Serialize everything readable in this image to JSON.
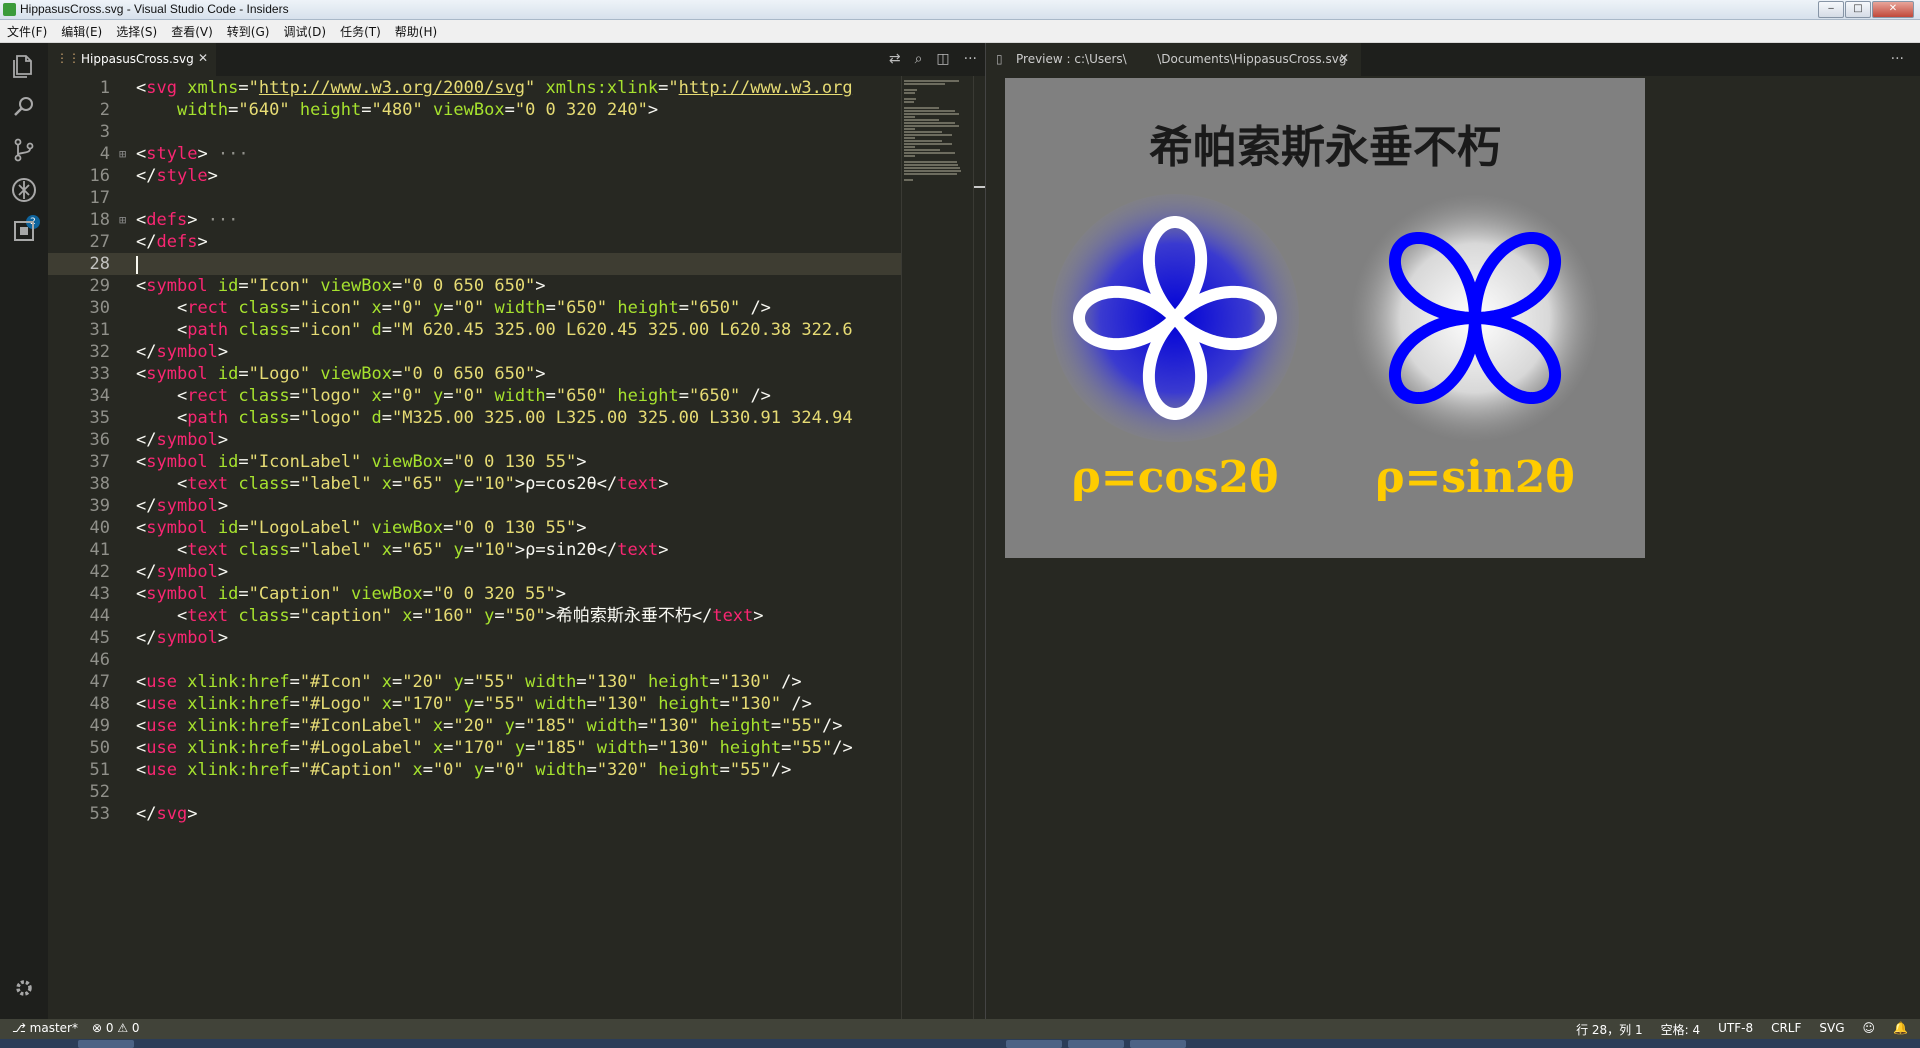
{
  "window": {
    "title": "HippasusCross.svg - Visual Studio Code - Insiders",
    "minimize": "‒",
    "maximize": "□",
    "close": "✕"
  },
  "menu": [
    "文件(F)",
    "编辑(E)",
    "选择(S)",
    "查看(V)",
    "转到(G)",
    "调试(D)",
    "任务(T)",
    "帮助(H)"
  ],
  "activity": {
    "explorer": "explorer-icon",
    "search": "search-icon",
    "scm": "source-control-icon",
    "scm_badge": "2",
    "debug": "debug-icon",
    "extensions": "extensions-icon",
    "settings": "gear-icon"
  },
  "tabs": {
    "editor": {
      "label": "HippasusCross.svg",
      "close": "✕"
    },
    "preview": {
      "label": "Preview : c:\\Users\\        \\Documents\\HippasusCross.svg",
      "close": "✕"
    },
    "more": "···"
  },
  "code_lines": [
    {
      "n": "1",
      "fold": false,
      "html": "<span class=\"p\">&lt;</span><span class=\"t\">svg</span> <span class=\"a\">xmlns</span><span class=\"p\">=</span><span class=\"s\">\"</span><span class=\"u\">http://www.w3.org/2000/svg</span><span class=\"s\">\"</span> <span class=\"a\">xmlns:xlink</span><span class=\"p\">=</span><span class=\"s\">\"</span><span class=\"u\">http://www.w3.org</span>"
    },
    {
      "n": "2",
      "fold": false,
      "html": "    <span class=\"a\">width</span><span class=\"p\">=</span><span class=\"s\">\"640\"</span> <span class=\"a\">height</span><span class=\"p\">=</span><span class=\"s\">\"480\"</span> <span class=\"a\">viewBox</span><span class=\"p\">=</span><span class=\"s\">\"0 0 320 240\"</span><span class=\"p\">&gt;</span>"
    },
    {
      "n": "3",
      "fold": false,
      "html": ""
    },
    {
      "n": "4",
      "fold": true,
      "html": "<span class=\"p\">&lt;</span><span class=\"t\">style</span><span class=\"p\">&gt;</span><span class=\"g\"> ···</span>"
    },
    {
      "n": "16",
      "fold": false,
      "html": "<span class=\"p\">&lt;/</span><span class=\"t\">style</span><span class=\"p\">&gt;</span>"
    },
    {
      "n": "17",
      "fold": false,
      "html": ""
    },
    {
      "n": "18",
      "fold": true,
      "html": "<span class=\"p\">&lt;</span><span class=\"t\">defs</span><span class=\"p\">&gt;</span><span class=\"g\"> ···</span>"
    },
    {
      "n": "27",
      "fold": false,
      "html": "<span class=\"p\">&lt;/</span><span class=\"t\">defs</span><span class=\"p\">&gt;</span>"
    },
    {
      "n": "28",
      "fold": false,
      "current": true,
      "html": ""
    },
    {
      "n": "29",
      "fold": false,
      "html": "<span class=\"p\">&lt;</span><span class=\"t\">symbol</span> <span class=\"a\">id</span><span class=\"p\">=</span><span class=\"s\">\"Icon\"</span> <span class=\"a\">viewBox</span><span class=\"p\">=</span><span class=\"s\">\"0 0 650 650\"</span><span class=\"p\">&gt;</span>"
    },
    {
      "n": "30",
      "fold": false,
      "html": "    <span class=\"p\">&lt;</span><span class=\"t\">rect</span> <span class=\"a\">class</span><span class=\"p\">=</span><span class=\"s\">\"icon\"</span> <span class=\"a\">x</span><span class=\"p\">=</span><span class=\"s\">\"0\"</span> <span class=\"a\">y</span><span class=\"p\">=</span><span class=\"s\">\"0\"</span> <span class=\"a\">width</span><span class=\"p\">=</span><span class=\"s\">\"650\"</span> <span class=\"a\">height</span><span class=\"p\">=</span><span class=\"s\">\"650\"</span> <span class=\"p\">/&gt;</span>"
    },
    {
      "n": "31",
      "fold": false,
      "html": "    <span class=\"p\">&lt;</span><span class=\"t\">path</span> <span class=\"a\">class</span><span class=\"p\">=</span><span class=\"s\">\"icon\"</span> <span class=\"a\">d</span><span class=\"p\">=</span><span class=\"s\">\"M 620.45 325.00 L620.45 325.00 L620.38 322.6</span>"
    },
    {
      "n": "32",
      "fold": false,
      "html": "<span class=\"p\">&lt;/</span><span class=\"t\">symbol</span><span class=\"p\">&gt;</span>"
    },
    {
      "n": "33",
      "fold": false,
      "html": "<span class=\"p\">&lt;</span><span class=\"t\">symbol</span> <span class=\"a\">id</span><span class=\"p\">=</span><span class=\"s\">\"Logo\"</span> <span class=\"a\">viewBox</span><span class=\"p\">=</span><span class=\"s\">\"0 0 650 650\"</span><span class=\"p\">&gt;</span>"
    },
    {
      "n": "34",
      "fold": false,
      "html": "    <span class=\"p\">&lt;</span><span class=\"t\">rect</span> <span class=\"a\">class</span><span class=\"p\">=</span><span class=\"s\">\"logo\"</span> <span class=\"a\">x</span><span class=\"p\">=</span><span class=\"s\">\"0\"</span> <span class=\"a\">y</span><span class=\"p\">=</span><span class=\"s\">\"0\"</span> <span class=\"a\">width</span><span class=\"p\">=</span><span class=\"s\">\"650\"</span> <span class=\"a\">height</span><span class=\"p\">=</span><span class=\"s\">\"650\"</span> <span class=\"p\">/&gt;</span>"
    },
    {
      "n": "35",
      "fold": false,
      "html": "    <span class=\"p\">&lt;</span><span class=\"t\">path</span> <span class=\"a\">class</span><span class=\"p\">=</span><span class=\"s\">\"logo\"</span> <span class=\"a\">d</span><span class=\"p\">=</span><span class=\"s\">\"M325.00 325.00 L325.00 325.00 L330.91 324.94</span>"
    },
    {
      "n": "36",
      "fold": false,
      "html": "<span class=\"p\">&lt;/</span><span class=\"t\">symbol</span><span class=\"p\">&gt;</span>"
    },
    {
      "n": "37",
      "fold": false,
      "html": "<span class=\"p\">&lt;</span><span class=\"t\">symbol</span> <span class=\"a\">id</span><span class=\"p\">=</span><span class=\"s\">\"IconLabel\"</span> <span class=\"a\">viewBox</span><span class=\"p\">=</span><span class=\"s\">\"0 0 130 55\"</span><span class=\"p\">&gt;</span>"
    },
    {
      "n": "38",
      "fold": false,
      "html": "    <span class=\"p\">&lt;</span><span class=\"t\">text</span> <span class=\"a\">class</span><span class=\"p\">=</span><span class=\"s\">\"label\"</span> <span class=\"a\">x</span><span class=\"p\">=</span><span class=\"s\">\"65\"</span> <span class=\"a\">y</span><span class=\"p\">=</span><span class=\"s\">\"10\"</span><span class=\"p\">&gt;ρ=cos2θ&lt;/</span><span class=\"t\">text</span><span class=\"p\">&gt;</span>"
    },
    {
      "n": "39",
      "fold": false,
      "html": "<span class=\"p\">&lt;/</span><span class=\"t\">symbol</span><span class=\"p\">&gt;</span>"
    },
    {
      "n": "40",
      "fold": false,
      "html": "<span class=\"p\">&lt;</span><span class=\"t\">symbol</span> <span class=\"a\">id</span><span class=\"p\">=</span><span class=\"s\">\"LogoLabel\"</span> <span class=\"a\">viewBox</span><span class=\"p\">=</span><span class=\"s\">\"0 0 130 55\"</span><span class=\"p\">&gt;</span>"
    },
    {
      "n": "41",
      "fold": false,
      "html": "    <span class=\"p\">&lt;</span><span class=\"t\">text</span> <span class=\"a\">class</span><span class=\"p\">=</span><span class=\"s\">\"label\"</span> <span class=\"a\">x</span><span class=\"p\">=</span><span class=\"s\">\"65\"</span> <span class=\"a\">y</span><span class=\"p\">=</span><span class=\"s\">\"10\"</span><span class=\"p\">&gt;ρ=sin2θ&lt;/</span><span class=\"t\">text</span><span class=\"p\">&gt;</span>"
    },
    {
      "n": "42",
      "fold": false,
      "html": "<span class=\"p\">&lt;/</span><span class=\"t\">symbol</span><span class=\"p\">&gt;</span>"
    },
    {
      "n": "43",
      "fold": false,
      "html": "<span class=\"p\">&lt;</span><span class=\"t\">symbol</span> <span class=\"a\">id</span><span class=\"p\">=</span><span class=\"s\">\"Caption\"</span> <span class=\"a\">viewBox</span><span class=\"p\">=</span><span class=\"s\">\"0 0 320 55\"</span><span class=\"p\">&gt;</span>"
    },
    {
      "n": "44",
      "fold": false,
      "html": "    <span class=\"p\">&lt;</span><span class=\"t\">text</span> <span class=\"a\">class</span><span class=\"p\">=</span><span class=\"s\">\"caption\"</span> <span class=\"a\">x</span><span class=\"p\">=</span><span class=\"s\">\"160\"</span> <span class=\"a\">y</span><span class=\"p\">=</span><span class=\"s\">\"50\"</span><span class=\"p\">&gt;希帕索斯永垂不朽&lt;/</span><span class=\"t\">text</span><span class=\"p\">&gt;</span>"
    },
    {
      "n": "45",
      "fold": false,
      "html": "<span class=\"p\">&lt;/</span><span class=\"t\">symbol</span><span class=\"p\">&gt;</span>"
    },
    {
      "n": "46",
      "fold": false,
      "html": ""
    },
    {
      "n": "47",
      "fold": false,
      "html": "<span class=\"p\">&lt;</span><span class=\"t\">use</span> <span class=\"a\">xlink:href</span><span class=\"p\">=</span><span class=\"s\">\"#Icon\"</span> <span class=\"a\">x</span><span class=\"p\">=</span><span class=\"s\">\"20\"</span> <span class=\"a\">y</span><span class=\"p\">=</span><span class=\"s\">\"55\"</span> <span class=\"a\">width</span><span class=\"p\">=</span><span class=\"s\">\"130\"</span> <span class=\"a\">height</span><span class=\"p\">=</span><span class=\"s\">\"130\"</span> <span class=\"p\">/&gt;</span>"
    },
    {
      "n": "48",
      "fold": false,
      "html": "<span class=\"p\">&lt;</span><span class=\"t\">use</span> <span class=\"a\">xlink:href</span><span class=\"p\">=</span><span class=\"s\">\"#Logo\"</span> <span class=\"a\">x</span><span class=\"p\">=</span><span class=\"s\">\"170\"</span> <span class=\"a\">y</span><span class=\"p\">=</span><span class=\"s\">\"55\"</span> <span class=\"a\">width</span><span class=\"p\">=</span><span class=\"s\">\"130\"</span> <span class=\"a\">height</span><span class=\"p\">=</span><span class=\"s\">\"130\"</span> <span class=\"p\">/&gt;</span>"
    },
    {
      "n": "49",
      "fold": false,
      "html": "<span class=\"p\">&lt;</span><span class=\"t\">use</span> <span class=\"a\">xlink:href</span><span class=\"p\">=</span><span class=\"s\">\"#IconLabel\"</span> <span class=\"a\">x</span><span class=\"p\">=</span><span class=\"s\">\"20\"</span> <span class=\"a\">y</span><span class=\"p\">=</span><span class=\"s\">\"185\"</span> <span class=\"a\">width</span><span class=\"p\">=</span><span class=\"s\">\"130\"</span> <span class=\"a\">height</span><span class=\"p\">=</span><span class=\"s\">\"55\"</span><span class=\"p\">/&gt;</span>"
    },
    {
      "n": "50",
      "fold": false,
      "html": "<span class=\"p\">&lt;</span><span class=\"t\">use</span> <span class=\"a\">xlink:href</span><span class=\"p\">=</span><span class=\"s\">\"#LogoLabel\"</span> <span class=\"a\">x</span><span class=\"p\">=</span><span class=\"s\">\"170\"</span> <span class=\"a\">y</span><span class=\"p\">=</span><span class=\"s\">\"185\"</span> <span class=\"a\">width</span><span class=\"p\">=</span><span class=\"s\">\"130\"</span> <span class=\"a\">height</span><span class=\"p\">=</span><span class=\"s\">\"55\"</span><span class=\"p\">/&gt;</span>"
    },
    {
      "n": "51",
      "fold": false,
      "html": "<span class=\"p\">&lt;</span><span class=\"t\">use</span> <span class=\"a\">xlink:href</span><span class=\"p\">=</span><span class=\"s\">\"#Caption\"</span> <span class=\"a\">x</span><span class=\"p\">=</span><span class=\"s\">\"0\"</span> <span class=\"a\">y</span><span class=\"p\">=</span><span class=\"s\">\"0\"</span> <span class=\"a\">width</span><span class=\"p\">=</span><span class=\"s\">\"320\"</span> <span class=\"a\">height</span><span class=\"p\">=</span><span class=\"s\">\"55\"</span><span class=\"p\">/&gt;</span>"
    },
    {
      "n": "52",
      "fold": false,
      "html": ""
    },
    {
      "n": "53",
      "fold": false,
      "html": "<span class=\"p\">&lt;/</span><span class=\"t\">svg</span><span class=\"p\">&gt;</span>"
    }
  ],
  "preview": {
    "caption": "希帕索斯永垂不朽",
    "icon_label": "ρ=cos2θ",
    "logo_label": "ρ=sin2θ",
    "colors": {
      "background": "#808080",
      "icon_fill": "#2a2ad8",
      "icon_stroke": "#ffffff",
      "logo_stroke": "#0000ff",
      "label": "#ffcc00",
      "caption": "#1a1a1a"
    }
  },
  "status": {
    "branch": "master*",
    "errors": "0",
    "warnings": "0",
    "position": "行 28，列 1",
    "indent": "空格: 4",
    "encoding": "UTF-8",
    "eol": "CRLF",
    "language": "SVG",
    "feedback": "☺",
    "bell": "🔔"
  }
}
